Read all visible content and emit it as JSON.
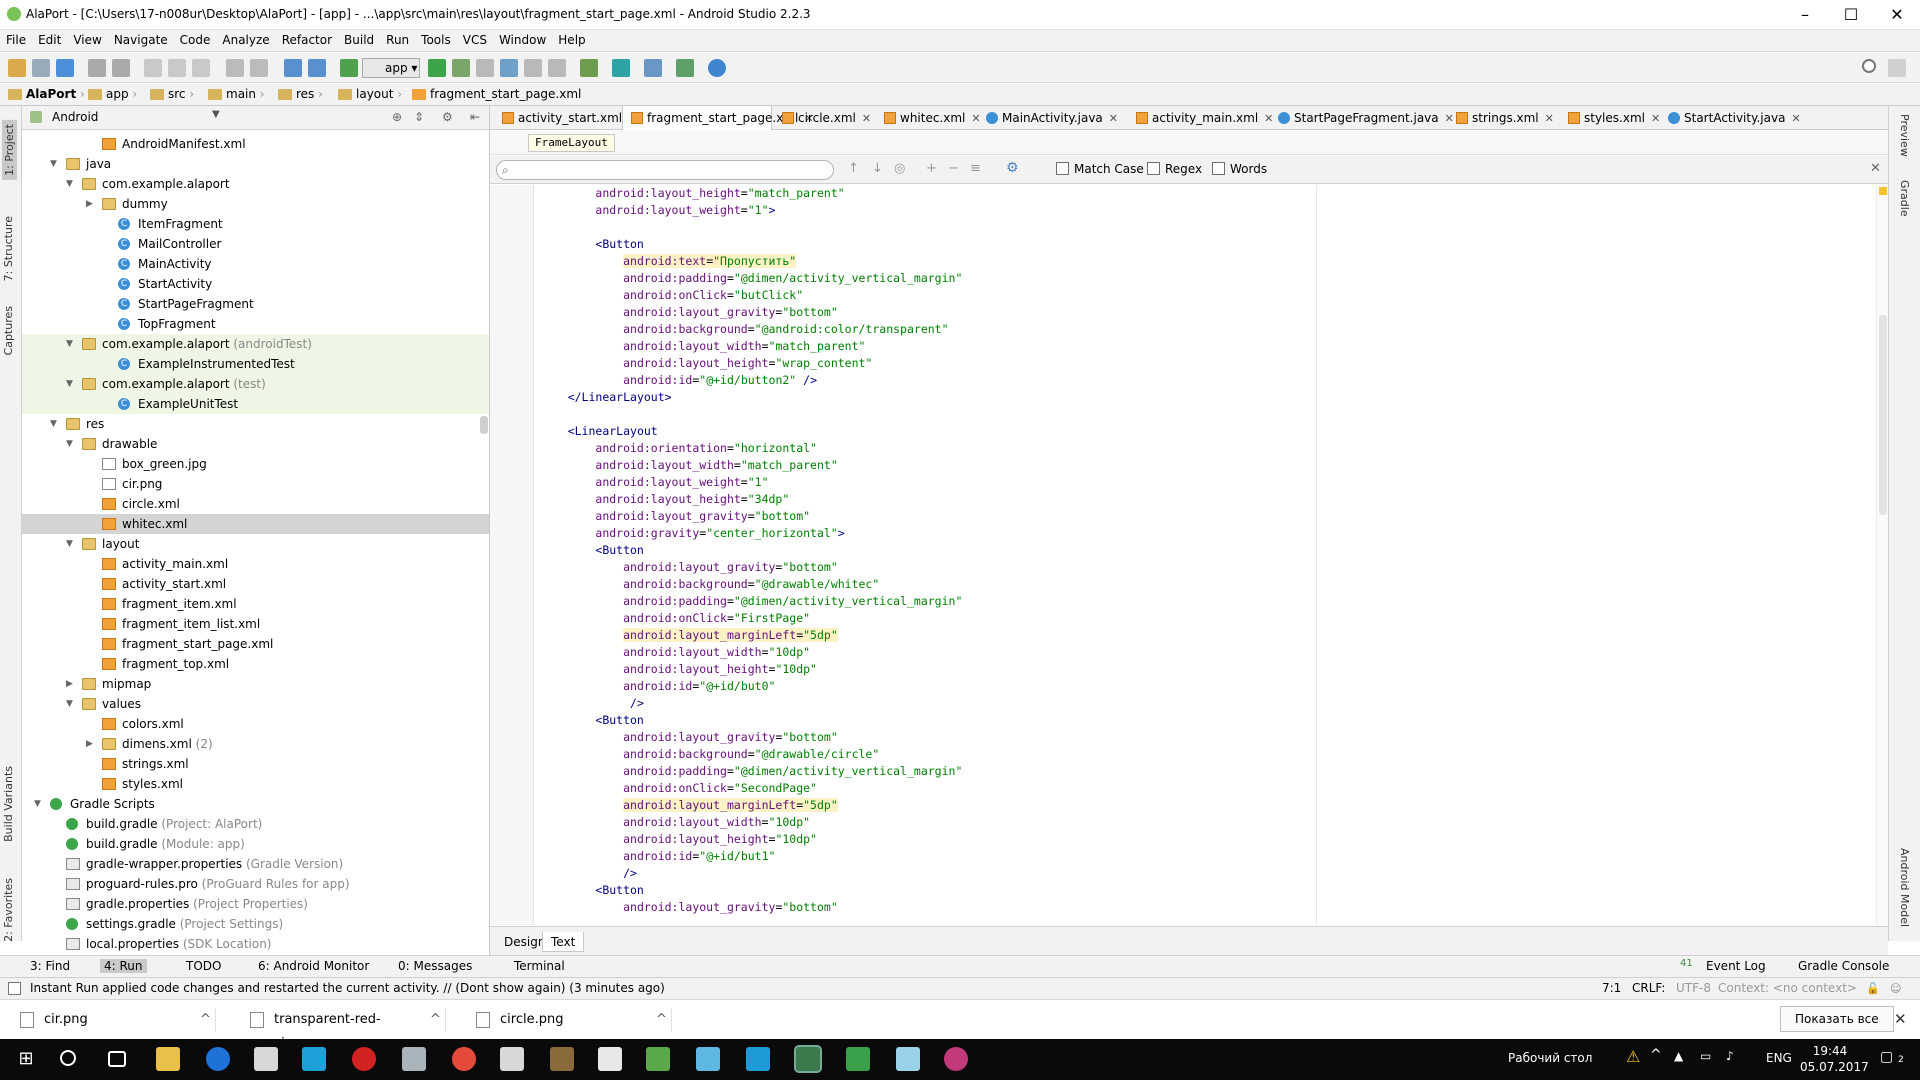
{
  "window": {
    "title": "AlaPort - [C:\\Users\\17-n008ur\\Desktop\\AlaPort] - [app] - ...\\app\\src\\main\\res\\layout\\fragment_start_page.xml - Android Studio 2.2.3",
    "minimize": "–",
    "maximize": "☐",
    "close": "✕"
  },
  "menu": [
    "File",
    "Edit",
    "View",
    "Navigate",
    "Code",
    "Analyze",
    "Refactor",
    "Build",
    "Run",
    "Tools",
    "VCS",
    "Window",
    "Help"
  ],
  "toolbar": {
    "run_config": "app"
  },
  "navbar": [
    "AlaPort",
    "app",
    "src",
    "main",
    "res",
    "layout",
    "fragment_start_page.xml"
  ],
  "left_tool_tabs": [
    "1: Project",
    "7: Structure",
    "Captures",
    "Build Variants",
    "2: Favorites"
  ],
  "right_tool_tabs": [
    "Preview",
    "Gradle",
    "Android Model"
  ],
  "project": {
    "view_mode": "Android",
    "tree": [
      {
        "label": "AndroidManifest.xml",
        "sub": "",
        "icon": "xml",
        "level": 3,
        "arrow": ""
      },
      {
        "label": "java",
        "sub": "",
        "icon": "folder",
        "level": 1,
        "arrow": "▼"
      },
      {
        "label": "com.example.alaport",
        "sub": "",
        "icon": "pkg",
        "level": 2,
        "arrow": "▼"
      },
      {
        "label": "dummy",
        "sub": "",
        "icon": "folder",
        "level": 3,
        "arrow": "▶"
      },
      {
        "label": "ItemFragment",
        "sub": "",
        "icon": "cls",
        "level": 4,
        "arrow": ""
      },
      {
        "label": "MailController",
        "sub": "",
        "icon": "cls",
        "level": 4,
        "arrow": ""
      },
      {
        "label": "MainActivity",
        "sub": "",
        "icon": "cls",
        "level": 4,
        "arrow": ""
      },
      {
        "label": "StartActivity",
        "sub": "",
        "icon": "cls",
        "level": 4,
        "arrow": ""
      },
      {
        "label": "StartPageFragment",
        "sub": "",
        "icon": "cls",
        "level": 4,
        "arrow": ""
      },
      {
        "label": "TopFragment",
        "sub": "",
        "icon": "cls",
        "level": 4,
        "arrow": ""
      },
      {
        "label": "com.example.alaport",
        "sub": " (androidTest)",
        "icon": "pkg",
        "level": 2,
        "arrow": "▼",
        "hl": true
      },
      {
        "label": "ExampleInstrumentedTest",
        "sub": "",
        "icon": "cls",
        "level": 4,
        "arrow": "",
        "hl": true
      },
      {
        "label": "com.example.alaport",
        "sub": " (test)",
        "icon": "pkg",
        "level": 2,
        "arrow": "▼",
        "hl": true
      },
      {
        "label": "ExampleUnitTest",
        "sub": "",
        "icon": "cls",
        "level": 4,
        "arrow": "",
        "hl": true
      },
      {
        "label": "res",
        "sub": "",
        "icon": "folder",
        "level": 1,
        "arrow": "▼"
      },
      {
        "label": "drawable",
        "sub": "",
        "icon": "folder",
        "level": 2,
        "arrow": "▼"
      },
      {
        "label": "box_green.jpg",
        "sub": "",
        "icon": "img",
        "level": 3,
        "arrow": ""
      },
      {
        "label": "cir.png",
        "sub": "",
        "icon": "img",
        "level": 3,
        "arrow": ""
      },
      {
        "label": "circle.xml",
        "sub": "",
        "icon": "xml",
        "level": 3,
        "arrow": ""
      },
      {
        "label": "whitec.xml",
        "sub": "",
        "icon": "xml",
        "level": 3,
        "arrow": "",
        "sel": true
      },
      {
        "label": "layout",
        "sub": "",
        "icon": "folder",
        "level": 2,
        "arrow": "▼"
      },
      {
        "label": "activity_main.xml",
        "sub": "",
        "icon": "xml",
        "level": 3,
        "arrow": ""
      },
      {
        "label": "activity_start.xml",
        "sub": "",
        "icon": "xml",
        "level": 3,
        "arrow": ""
      },
      {
        "label": "fragment_item.xml",
        "sub": "",
        "icon": "xml",
        "level": 3,
        "arrow": ""
      },
      {
        "label": "fragment_item_list.xml",
        "sub": "",
        "icon": "xml",
        "level": 3,
        "arrow": ""
      },
      {
        "label": "fragment_start_page.xml",
        "sub": "",
        "icon": "xml",
        "level": 3,
        "arrow": ""
      },
      {
        "label": "fragment_top.xml",
        "sub": "",
        "icon": "xml",
        "level": 3,
        "arrow": ""
      },
      {
        "label": "mipmap",
        "sub": "",
        "icon": "folder",
        "level": 2,
        "arrow": "▶"
      },
      {
        "label": "values",
        "sub": "",
        "icon": "folder",
        "level": 2,
        "arrow": "▼"
      },
      {
        "label": "colors.xml",
        "sub": "",
        "icon": "xml",
        "level": 3,
        "arrow": ""
      },
      {
        "label": "dimens.xml",
        "sub": " (2)",
        "icon": "folder",
        "level": 3,
        "arrow": "▶"
      },
      {
        "label": "strings.xml",
        "sub": "",
        "icon": "xml",
        "level": 3,
        "arrow": ""
      },
      {
        "label": "styles.xml",
        "sub": "",
        "icon": "xml",
        "level": 3,
        "arrow": ""
      },
      {
        "label": "Gradle Scripts",
        "sub": "",
        "icon": "grad",
        "level": 0,
        "arrow": "▼"
      },
      {
        "label": "build.gradle",
        "sub": " (Project: AlaPort)",
        "icon": "grad",
        "level": 1,
        "arrow": ""
      },
      {
        "label": "build.gradle",
        "sub": " (Module: app)",
        "icon": "grad",
        "level": 1,
        "arrow": ""
      },
      {
        "label": "gradle-wrapper.properties",
        "sub": " (Gradle Version)",
        "icon": "prop",
        "level": 1,
        "arrow": ""
      },
      {
        "label": "proguard-rules.pro",
        "sub": " (ProGuard Rules for app)",
        "icon": "prop",
        "level": 1,
        "arrow": ""
      },
      {
        "label": "gradle.properties",
        "sub": " (Project Properties)",
        "icon": "prop",
        "level": 1,
        "arrow": ""
      },
      {
        "label": "settings.gradle",
        "sub": " (Project Settings)",
        "icon": "grad",
        "level": 1,
        "arrow": ""
      },
      {
        "label": "local.properties",
        "sub": " (SDK Location)",
        "icon": "prop",
        "level": 1,
        "arrow": ""
      }
    ]
  },
  "editor": {
    "tabs": [
      {
        "label": "activity_start.xml",
        "icon": "xml",
        "active": false
      },
      {
        "label": "fragment_start_page.xml",
        "icon": "xml",
        "active": true
      },
      {
        "label": "circle.xml",
        "icon": "xml",
        "active": false
      },
      {
        "label": "whitec.xml",
        "icon": "xml",
        "active": false
      },
      {
        "label": "MainActivity.java",
        "icon": "cls",
        "active": false
      },
      {
        "label": "activity_main.xml",
        "icon": "xml",
        "active": false
      },
      {
        "label": "StartPageFragment.java",
        "icon": "cls",
        "active": false
      },
      {
        "label": "strings.xml",
        "icon": "xml",
        "active": false
      },
      {
        "label": "styles.xml",
        "icon": "xml",
        "active": false
      },
      {
        "label": "StartActivity.java",
        "icon": "cls",
        "active": false
      }
    ],
    "breadcrumb_element": "FrameLayout",
    "find": {
      "value": "",
      "placeholder": "",
      "match_case": "Match Case",
      "regex": "Regex",
      "words": "Words"
    },
    "code_lines": [
      {
        "indent": "        ",
        "attr": "android:layout_height",
        "val": "\"match_parent\"",
        "end": ""
      },
      {
        "indent": "        ",
        "attr": "android:layout_weight",
        "val": "\"1\"",
        "end": ">"
      },
      {
        "indent": "",
        "raw": ""
      },
      {
        "indent": "        ",
        "tag": "<Button",
        "end": ""
      },
      {
        "indent": "            ",
        "attr": "android:text",
        "val": "\"Пропустить\"",
        "end": "",
        "mark": true
      },
      {
        "indent": "            ",
        "attr": "android:padding",
        "val": "\"@dimen/activity_vertical_margin\"",
        "end": ""
      },
      {
        "indent": "            ",
        "attr": "android:onClick",
        "val": "\"butClick\"",
        "end": ""
      },
      {
        "indent": "            ",
        "attr": "android:layout_gravity",
        "val": "\"bottom\"",
        "end": ""
      },
      {
        "indent": "            ",
        "attr": "android:background",
        "val": "\"@android:color/transparent\"",
        "end": ""
      },
      {
        "indent": "            ",
        "attr": "android:layout_width",
        "val": "\"match_parent\"",
        "end": ""
      },
      {
        "indent": "            ",
        "attr": "android:layout_height",
        "val": "\"wrap_content\"",
        "end": ""
      },
      {
        "indent": "            ",
        "attr": "android:id",
        "val": "\"@+id/button2\"",
        "end": " />"
      },
      {
        "indent": "    ",
        "tag": "</LinearLayout>",
        "end": ""
      },
      {
        "indent": "",
        "raw": ""
      },
      {
        "indent": "    ",
        "tag": "<LinearLayout",
        "end": ""
      },
      {
        "indent": "        ",
        "attr": "android:orientation",
        "val": "\"horizontal\"",
        "end": ""
      },
      {
        "indent": "        ",
        "attr": "android:layout_width",
        "val": "\"match_parent\"",
        "end": ""
      },
      {
        "indent": "        ",
        "attr": "android:layout_weight",
        "val": "\"1\"",
        "end": ""
      },
      {
        "indent": "        ",
        "attr": "android:layout_height",
        "val": "\"34dp\"",
        "end": ""
      },
      {
        "indent": "        ",
        "attr": "android:layout_gravity",
        "val": "\"bottom\"",
        "end": ""
      },
      {
        "indent": "        ",
        "attr": "android:gravity",
        "val": "\"center_horizontal\"",
        "end": ">"
      },
      {
        "indent": "        ",
        "tag": "<Button",
        "end": ""
      },
      {
        "indent": "            ",
        "attr": "android:layout_gravity",
        "val": "\"bottom\"",
        "end": ""
      },
      {
        "indent": "            ",
        "attr": "android:background",
        "val": "\"@drawable/whitec\"",
        "end": ""
      },
      {
        "indent": "            ",
        "attr": "android:padding",
        "val": "\"@dimen/activity_vertical_margin\"",
        "end": ""
      },
      {
        "indent": "            ",
        "attr": "android:onClick",
        "val": "\"FirstPage\"",
        "end": ""
      },
      {
        "indent": "            ",
        "attr": "android:layout_marginLeft",
        "val": "\"5dp\"",
        "end": "",
        "mark": true
      },
      {
        "indent": "            ",
        "attr": "android:layout_width",
        "val": "\"10dp\"",
        "end": ""
      },
      {
        "indent": "            ",
        "attr": "android:layout_height",
        "val": "\"10dp\"",
        "end": ""
      },
      {
        "indent": "            ",
        "attr": "android:id",
        "val": "\"@+id/but0\"",
        "end": ""
      },
      {
        "indent": "             ",
        "raw": "/>"
      },
      {
        "indent": "        ",
        "tag": "<Button",
        "end": ""
      },
      {
        "indent": "            ",
        "attr": "android:layout_gravity",
        "val": "\"bottom\"",
        "end": ""
      },
      {
        "indent": "            ",
        "attr": "android:background",
        "val": "\"@drawable/circle\"",
        "end": ""
      },
      {
        "indent": "            ",
        "attr": "android:padding",
        "val": "\"@dimen/activity_vertical_margin\"",
        "end": ""
      },
      {
        "indent": "            ",
        "attr": "android:onClick",
        "val": "\"SecondPage\"",
        "end": ""
      },
      {
        "indent": "            ",
        "attr": "android:layout_marginLeft",
        "val": "\"5dp\"",
        "end": "",
        "mark": true
      },
      {
        "indent": "            ",
        "attr": "android:layout_width",
        "val": "\"10dp\"",
        "end": ""
      },
      {
        "indent": "            ",
        "attr": "android:layout_height",
        "val": "\"10dp\"",
        "end": ""
      },
      {
        "indent": "            ",
        "attr": "android:id",
        "val": "\"@+id/but1\"",
        "end": ""
      },
      {
        "indent": "            ",
        "raw": "/>"
      },
      {
        "indent": "        ",
        "tag": "<Button",
        "end": ""
      },
      {
        "indent": "            ",
        "attr": "android:layout_gravity",
        "val": "\"bottom\"",
        "end": ""
      }
    ],
    "bottom_tabs": {
      "design": "Design",
      "text": "Text"
    }
  },
  "tool_windows": {
    "find": "3: Find",
    "run": "4: Run",
    "todo": "TODO",
    "monitor": "6: Android Monitor",
    "messages": "0: Messages",
    "terminal": "Terminal",
    "event_log": "Event Log",
    "event_count": "41",
    "gradle_console": "Gradle Console"
  },
  "status": {
    "message": "Instant Run applied code changes and restarted the current activity. // (Dont show again) (3 minutes ago)",
    "position": "7:1",
    "line_sep": "CRLF:",
    "encoding": "UTF-8",
    "context": "Context: <no context>"
  },
  "downloads": {
    "items": [
      "cir.png",
      "transparent-red-ci....svg",
      "circle.png"
    ],
    "show_all": "Показать все"
  },
  "taskbar": {
    "desktop": "Рабочий стол",
    "lang": "ENG",
    "time": "19:44",
    "date": "05.07.2017",
    "notif_count": "2"
  },
  "colors": {
    "tag": "#000080",
    "attr": "#660e7a",
    "value": "#008000",
    "highlight": "#fbf3c5",
    "test_pkg_bg": "#eef6e5"
  }
}
